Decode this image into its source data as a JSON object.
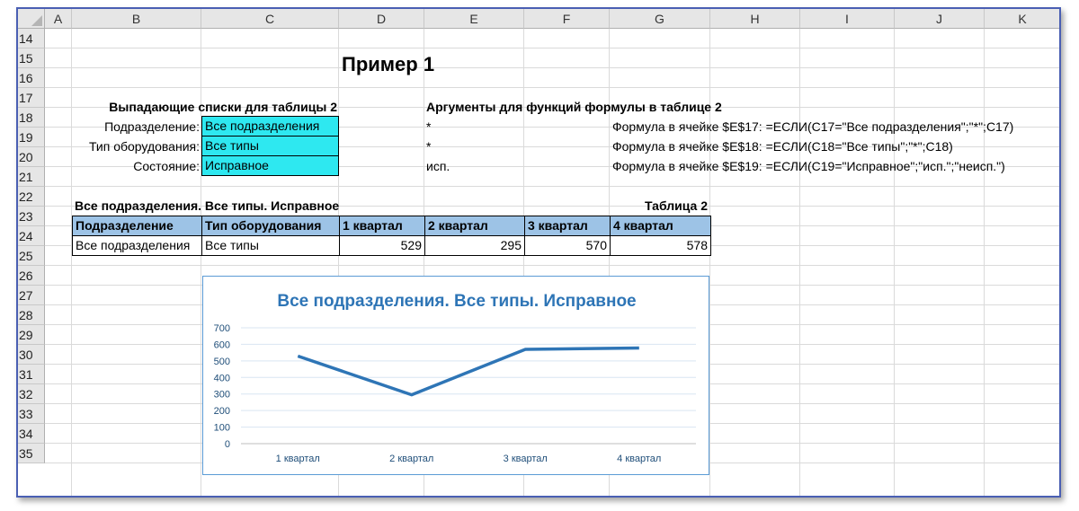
{
  "columns": [
    "A",
    "B",
    "C",
    "D",
    "E",
    "F",
    "G",
    "H",
    "I",
    "J",
    "K"
  ],
  "rows": [
    "14",
    "15",
    "16",
    "17",
    "18",
    "19",
    "20",
    "21",
    "22",
    "23",
    "24",
    "25",
    "26",
    "27",
    "28",
    "29",
    "30",
    "31",
    "32",
    "33",
    "34",
    "35"
  ],
  "sheet": {
    "title": "Пример 1",
    "dropdowns_header": "Выпадающие списки для таблицы 2",
    "args_header": "Аргументы для функций формулы в таблице 2",
    "labels": {
      "division": "Подразделение:",
      "equipment": "Тип оборудования:",
      "state": "Состояние:"
    },
    "values": {
      "division": "Все подразделения",
      "equipment": "Все типы",
      "state": "Исправное"
    },
    "args": {
      "e17": "*",
      "e18": "*",
      "e19": "исп."
    },
    "formulas": {
      "g17": "Формула в ячейке $E$17: =ЕСЛИ(C17=\"Все подразделения\";\"*\";C17)",
      "g18": "Формула в ячейке $E$18: =ЕСЛИ(C18=\"Все типы\";\"*\";C18)",
      "g19": "Формула в ячейке $E$19: =ЕСЛИ(C19=\"Исправное\";\"исп.\";\"неисп.\")"
    },
    "table_caption": "Все подразделения. Все типы. Исправное",
    "table_label": "Таблица 2",
    "table_headers": [
      "Подразделение",
      "Тип оборудования",
      "1 квартал",
      "2 квартал",
      "3 квартал",
      "4 квартал"
    ],
    "table_row": [
      "Все подразделения",
      "Все типы",
      "529",
      "295",
      "570",
      "578"
    ]
  },
  "colors": {
    "dropdown_fill": "#2ee8f0",
    "header_fill": "#9dc3e6",
    "chart_line": "#2e75b6",
    "chart_title": "#2e75b6",
    "frame_border": "#4a5fb3"
  },
  "chart_data": {
    "type": "line",
    "title": "Все подразделения. Все типы. Исправное",
    "categories": [
      "1 квартал",
      "2 квартал",
      "3 квартал",
      "4 квартал"
    ],
    "values": [
      529,
      295,
      570,
      578
    ],
    "yticks": [
      "0",
      "100",
      "200",
      "300",
      "400",
      "500",
      "600",
      "700"
    ],
    "ylim": [
      0,
      700
    ],
    "xlabel": "",
    "ylabel": "",
    "grid": true,
    "legend": "none"
  }
}
